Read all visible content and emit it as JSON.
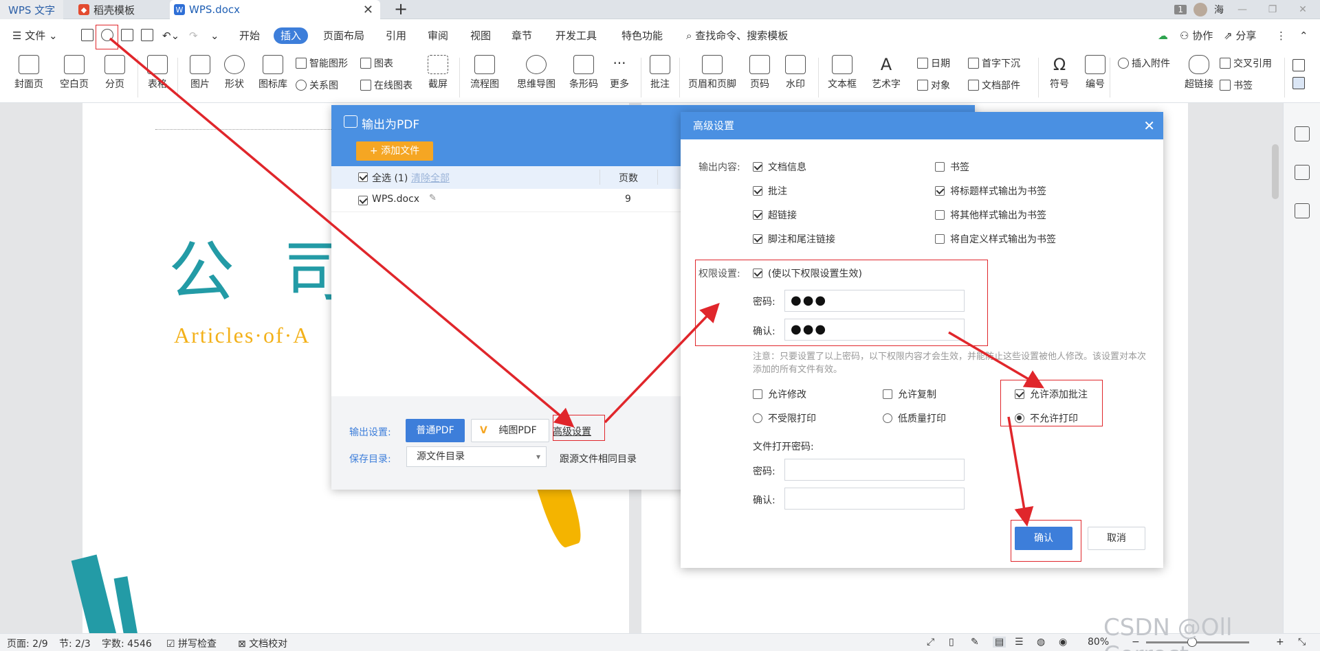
{
  "tabs": [
    {
      "label": "WPS 文字"
    },
    {
      "label": "稻壳模板"
    },
    {
      "label": "WPS.docx"
    }
  ],
  "titlebar_right": {
    "badge": "1",
    "user": "海"
  },
  "menu": {
    "file": "文件",
    "items": [
      "开始",
      "插入",
      "页面布局",
      "引用",
      "审阅",
      "视图",
      "章节",
      "开发工具",
      "特色功能"
    ],
    "active": "插入",
    "search": "查找命令、搜索模板",
    "right": [
      "协作",
      "分享"
    ]
  },
  "ribbon": {
    "big": [
      "封面页",
      "空白页",
      "分页",
      "表格",
      "图片",
      "形状",
      "图标库",
      "流程图",
      "思维导图",
      "条形码",
      "更多",
      "批注",
      "页眉和页脚",
      "页码",
      "水印",
      "文本框",
      "艺术字",
      "符号",
      "编号",
      "超链接"
    ],
    "small": [
      "智能图形",
      "图表",
      "关系图",
      "在线图表",
      "截屏",
      "日期",
      "首字下沉",
      "对象",
      "文档部件",
      "插入附件",
      "交叉引用",
      "书签"
    ]
  },
  "document": {
    "title": "公 司 ",
    "subtitle": "Articles·of·A"
  },
  "pdf_dialog": {
    "title": "输出为PDF",
    "add_file": "+ 添加文件",
    "select_all": "全选 (1)",
    "clear_all": "清除全部",
    "col_pages": "页数",
    "file": {
      "name": "WPS.docx",
      "pages": "9"
    },
    "output_label": "输出设置:",
    "btn_normal": "普通PDF",
    "btn_pure": "纯图PDF",
    "advanced_link": "高级设置",
    "save_label": "保存目录:",
    "save_value": "源文件目录",
    "save_hint": "跟源文件相同目录"
  },
  "adv_dialog": {
    "title": "高级设置",
    "content_label": "输出内容:",
    "left_opts": [
      {
        "label": "文档信息",
        "checked": true
      },
      {
        "label": "批注",
        "checked": true
      },
      {
        "label": "超链接",
        "checked": true
      },
      {
        "label": "脚注和尾注链接",
        "checked": true
      }
    ],
    "right_opts": [
      {
        "label": "书签",
        "checked": false
      },
      {
        "label": "将标题样式输出为书签",
        "checked": true
      },
      {
        "label": "将其他样式输出为书签",
        "checked": false
      },
      {
        "label": "将自定义样式输出为书签",
        "checked": false
      }
    ],
    "perm_label": "权限设置:",
    "perm_enable": "(使以下权限设置生效)",
    "pwd_label": "密码:",
    "confirm_label": "确认:",
    "pwd_value": "●●●",
    "confirm_value": "●●●",
    "note": "注意：只要设置了以上密码，以下权限内容才会生效，并能防止这些设置被他人修改。该设置对本次添加的所有文件有效。",
    "allow_modify": "允许修改",
    "allow_copy": "允许复制",
    "allow_comment": "允许添加批注",
    "print_unlimited": "不受限打印",
    "print_low": "低质量打印",
    "print_none": "不允许打印",
    "open_pwd_label": "文件打开密码:",
    "open_pwd": "密码:",
    "open_confirm": "确认:",
    "ok": "确认",
    "cancel": "取消"
  },
  "status": {
    "page": "页面: 2/9",
    "section": "节: 2/3",
    "words": "字数: 4546",
    "spell": "拼写检查",
    "proof": "文档校对",
    "zoom": "80%"
  },
  "watermark": "CSDN @Oll Correct",
  "colors": {
    "accent": "#3d7eda",
    "header": "#4a90e2",
    "annotation": "#e0262b",
    "orange": "#f5a623",
    "teal": "#239ba6"
  }
}
